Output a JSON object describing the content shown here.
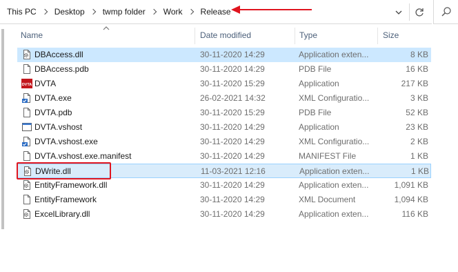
{
  "breadcrumb": [
    "This PC",
    "Desktop",
    "twmp folder",
    "Work",
    "Release"
  ],
  "columns": {
    "name": "Name",
    "date": "Date modified",
    "type": "Type",
    "size": "Size"
  },
  "files": [
    {
      "name": "DBAccess.dll",
      "date": "30-11-2020 14:29",
      "type": "Application exten...",
      "size": "8 KB",
      "icon": "dll-file-icon"
    },
    {
      "name": "DBAccess.pdb",
      "date": "30-11-2020 14:29",
      "type": "PDB File",
      "size": "16 KB",
      "icon": "blank-file-icon"
    },
    {
      "name": "DVTA",
      "date": "30-11-2020 15:29",
      "type": "Application",
      "size": "217 KB",
      "icon": "dvta-app-icon"
    },
    {
      "name": "DVTA.exe",
      "date": "26-02-2021 14:32",
      "type": "XML Configuratio...",
      "size": "3 KB",
      "icon": "config-file-icon"
    },
    {
      "name": "DVTA.pdb",
      "date": "30-11-2020 15:29",
      "type": "PDB File",
      "size": "52 KB",
      "icon": "blank-file-icon"
    },
    {
      "name": "DVTA.vshost",
      "date": "30-11-2020 14:29",
      "type": "Application",
      "size": "23 KB",
      "icon": "window-app-icon"
    },
    {
      "name": "DVTA.vshost.exe",
      "date": "30-11-2020 14:29",
      "type": "XML Configuratio...",
      "size": "2 KB",
      "icon": "config-file-icon"
    },
    {
      "name": "DVTA.vshost.exe.manifest",
      "date": "30-11-2020 14:29",
      "type": "MANIFEST File",
      "size": "1 KB",
      "icon": "blank-file-icon"
    },
    {
      "name": "DWrite.dll",
      "date": "11-03-2021 12:16",
      "type": "Application exten...",
      "size": "1 KB",
      "icon": "dll-file-icon"
    },
    {
      "name": "EntityFramework.dll",
      "date": "30-11-2020 14:29",
      "type": "Application exten...",
      "size": "1,091 KB",
      "icon": "dll-file-icon"
    },
    {
      "name": "EntityFramework",
      "date": "30-11-2020 14:29",
      "type": "XML Document",
      "size": "1,094 KB",
      "icon": "blank-file-icon"
    },
    {
      "name": "ExcelLibrary.dll",
      "date": "30-11-2020 14:29",
      "type": "Application exten...",
      "size": "116 KB",
      "icon": "dll-file-icon"
    }
  ],
  "dvta_icon_text": "DVTA",
  "colors": {
    "selection": "#cce8ff",
    "annotation": "#e0141e",
    "header_text": "#4c607a"
  }
}
